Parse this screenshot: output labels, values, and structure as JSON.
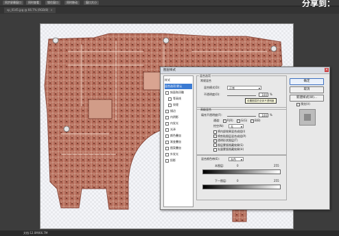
{
  "topbar": {
    "buttons": [
      "同步屏幕窗口",
      "同时查看",
      "锁住窗口",
      "同时移动",
      "窗口大小"
    ],
    "share_label": "分享到："
  },
  "document_tab": {
    "label": "sp_0145.jpg @ 66.7% (RGB/8)"
  },
  "status": {
    "text": "文档:12.0M/66.7M"
  },
  "dialog": {
    "title": "图层样式",
    "sidebar": {
      "items": [
        {
          "label": "样式",
          "checkbox": false,
          "selected": false,
          "sub": false
        },
        {
          "label": "混合选项:默认",
          "checkbox": false,
          "selected": true,
          "sub": false
        },
        {
          "label": "斜面和浮雕",
          "checkbox": true,
          "selected": false,
          "sub": false
        },
        {
          "label": "等高线",
          "checkbox": true,
          "selected": false,
          "sub": true
        },
        {
          "label": "纹理",
          "checkbox": true,
          "selected": false,
          "sub": true
        },
        {
          "label": "描边",
          "checkbox": true,
          "selected": false,
          "sub": false
        },
        {
          "label": "内阴影",
          "checkbox": true,
          "selected": false,
          "sub": false
        },
        {
          "label": "内发光",
          "checkbox": true,
          "selected": false,
          "sub": false
        },
        {
          "label": "光泽",
          "checkbox": true,
          "selected": false,
          "sub": false
        },
        {
          "label": "颜色叠加",
          "checkbox": true,
          "selected": false,
          "sub": false
        },
        {
          "label": "渐变叠加",
          "checkbox": true,
          "selected": false,
          "sub": false
        },
        {
          "label": "图案叠加",
          "checkbox": true,
          "selected": false,
          "sub": false
        },
        {
          "label": "外发光",
          "checkbox": true,
          "selected": false,
          "sub": false
        },
        {
          "label": "投影",
          "checkbox": true,
          "selected": false,
          "sub": false
        }
      ]
    },
    "general_blending": {
      "group_title": "混合选项",
      "sub_title": "常规混合",
      "blend_mode_label": "混合模式(D):",
      "blend_mode_value": "正常",
      "opacity_label": "不透明度(O):",
      "opacity_value": "100",
      "opacity_unit": "%",
      "tooltip": "设置图层的总体不透明度"
    },
    "advanced_blending": {
      "sub_title": "高级混合",
      "fill_opacity_label": "填充不透明度(F):",
      "fill_opacity_value": "100",
      "fill_opacity_unit": "%",
      "channels_label": "通道:",
      "channels": [
        "R(R)",
        "G(G)",
        "B(B)"
      ],
      "knockout_label": "挖空(N):",
      "knockout_value": "无",
      "options": [
        {
          "label": "将内部效果混合成组(I)",
          "checked": false
        },
        {
          "label": "将剪贴图层混合成组(P)",
          "checked": true
        },
        {
          "label": "透明形状图层(T)",
          "checked": true
        },
        {
          "label": "图层蒙版隐藏效果(S)",
          "checked": false
        },
        {
          "label": "矢量蒙版隐藏效果(H)",
          "checked": false
        }
      ]
    },
    "blend_if": {
      "label": "混合颜色带(E):",
      "value": "灰色",
      "this_layer_label": "本图层:",
      "this_layer_min": "0",
      "this_layer_max": "255",
      "underlying_label": "下一图层:",
      "underlying_min": "0",
      "underlying_max": "255"
    },
    "buttons": {
      "ok": "确定",
      "cancel": "取消",
      "new_style": "新建样式(W)...",
      "preview_label": "预览(V)",
      "preview_checked": true
    }
  }
}
